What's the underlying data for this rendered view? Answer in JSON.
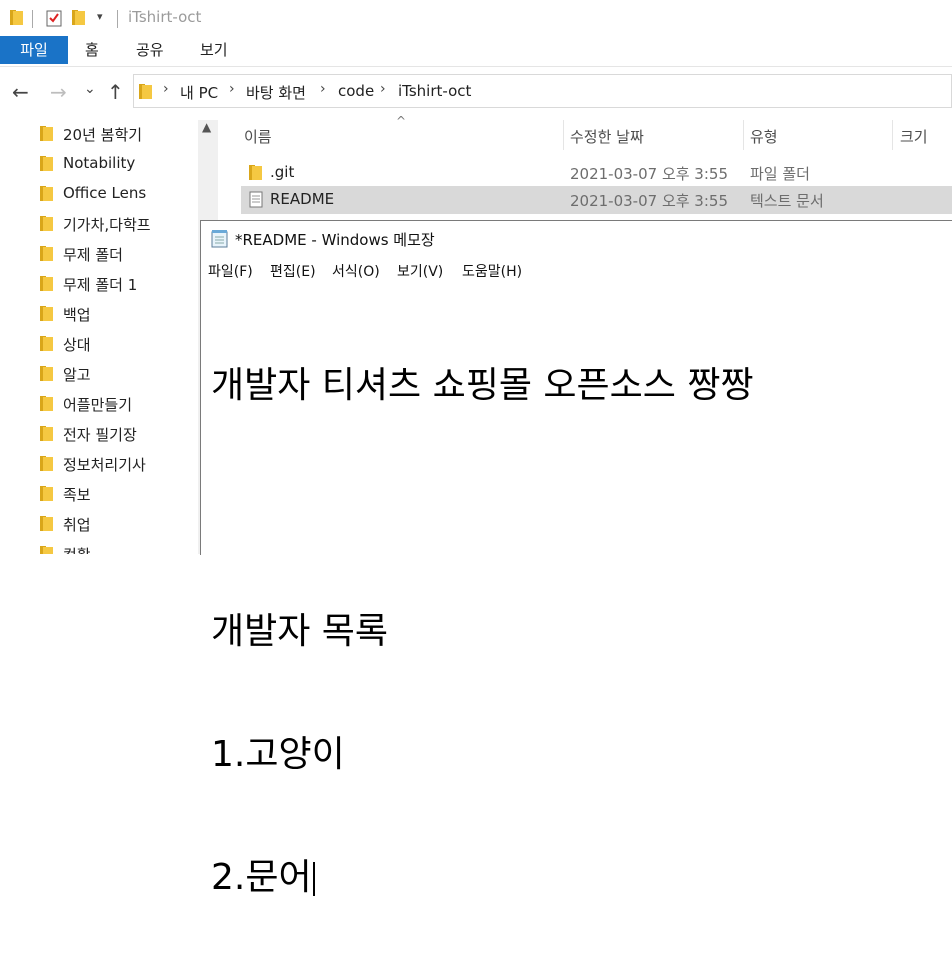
{
  "titlebar": {
    "title": "iTshirt-oct",
    "dropdown_glyph": "▾"
  },
  "ribbon": {
    "tabs": [
      "파일",
      "홈",
      "공유",
      "보기"
    ]
  },
  "nav": {
    "back_glyph": "←",
    "forward_glyph": "→",
    "recent_glyph": "⌄",
    "up_glyph": "↑",
    "breadcrumbs": [
      "내 PC",
      "바탕 화면",
      "code",
      "iTshirt-oct"
    ],
    "chevron_glyph": "›"
  },
  "sidebar": {
    "items": [
      "20년 봄학기",
      "Notability",
      "Office Lens",
      "기가차,다학프",
      "무제 폴더",
      "무제 폴더 1",
      "백업",
      "상대",
      "알고",
      "어플만들기",
      "전자 필기장",
      "정보처리기사",
      "족보",
      "취업",
      "컴활"
    ],
    "scroll_up_glyph": "▲"
  },
  "filelist": {
    "sort_glyph": "^",
    "columns": [
      "이름",
      "수정한 날짜",
      "유형",
      "크기"
    ],
    "rows": [
      {
        "name": ".git",
        "date": "2021-03-07 오후 3:55",
        "type": "파일 폴더",
        "icon": "folder-icon"
      },
      {
        "name": "README",
        "date": "2021-03-07 오후 3:55",
        "type": "텍스트 문서",
        "icon": "text-file-icon"
      }
    ]
  },
  "notepad": {
    "title": "*README - Windows 메모장",
    "menu": [
      "파일(F)",
      "편집(E)",
      "서식(O)",
      "보기(V)",
      "도움말(H)"
    ],
    "lines": [
      "개발자 티셔츠 쇼핑몰 오픈소스 짱짱",
      "",
      "개발자 목록",
      "1.고양이",
      "2.문어"
    ]
  },
  "colors": {
    "accent": "#1a73c7",
    "selection": "#d9d9d9",
    "folder": "#f5c842"
  }
}
